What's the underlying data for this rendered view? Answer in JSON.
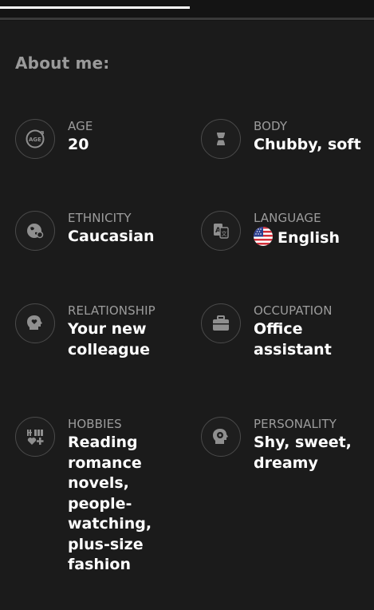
{
  "section_title": "About me:",
  "attributes": [
    {
      "id": "age",
      "label": "AGE",
      "value": "20",
      "icon": "age-icon"
    },
    {
      "id": "body",
      "label": "BODY",
      "value": "Chubby, soft",
      "icon": "body-icon"
    },
    {
      "id": "ethnicity",
      "label": "ETHNICITY",
      "value": "Caucasian",
      "icon": "ethnicity-icon"
    },
    {
      "id": "language",
      "label": "LANGUAGE",
      "value": "English",
      "icon": "language-icon",
      "flag": "us-flag-icon"
    },
    {
      "id": "relationship",
      "label": "RELATIONSHIP",
      "value": "Your new colleague",
      "icon": "relationship-icon"
    },
    {
      "id": "occupation",
      "label": "OCCUPATION",
      "value": "Office assistant",
      "icon": "briefcase-icon"
    },
    {
      "id": "hobbies",
      "label": "HOBBIES",
      "value": "Reading romance novels, people-watching, plus-size fashion",
      "icon": "hobbies-icon"
    },
    {
      "id": "personality",
      "label": "PERSONALITY",
      "value": "Shy, sweet, dreamy",
      "icon": "personality-icon"
    }
  ],
  "colors": {
    "background": "#1b1b1b",
    "label": "#9c9c9c",
    "value": "#ffffff",
    "title": "#9a9a9a"
  }
}
